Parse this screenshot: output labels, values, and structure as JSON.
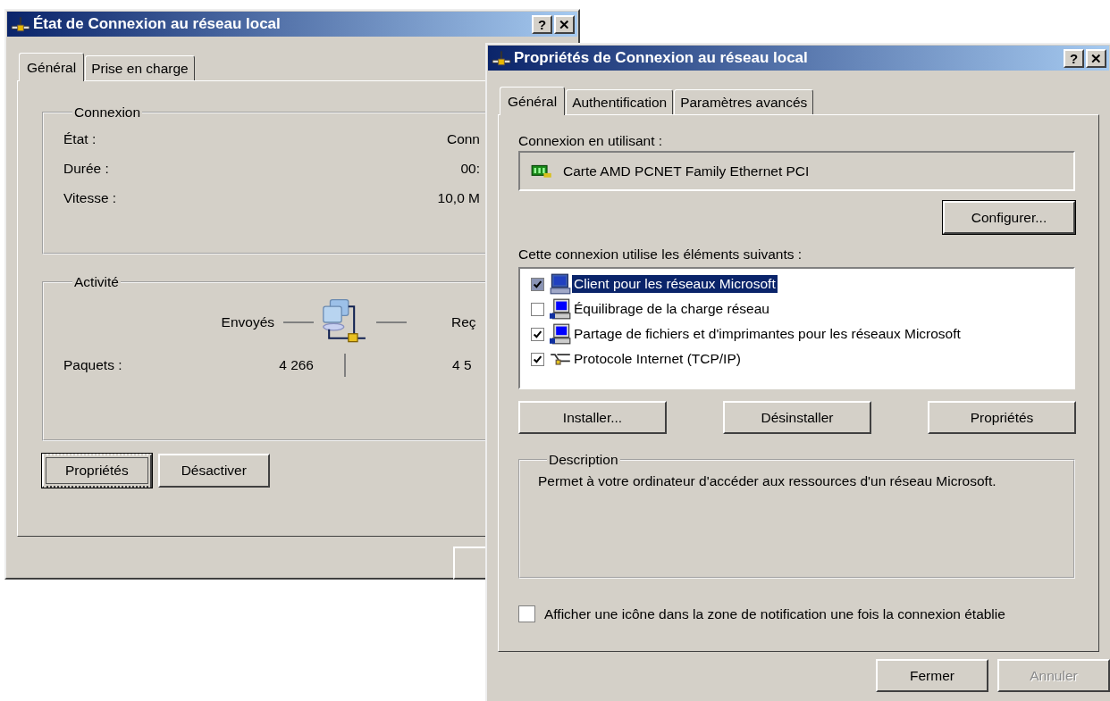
{
  "back_window": {
    "title": "État de Connexion au réseau local",
    "title_buttons": [
      "?",
      "✕"
    ],
    "tabs": [
      {
        "label": "Général",
        "selected": true
      },
      {
        "label": "Prise en charge",
        "selected": false
      }
    ],
    "connection_group": {
      "title": "Connexion",
      "rows": [
        {
          "label": "État :",
          "value": "Conn"
        },
        {
          "label": "Durée :",
          "value": "00:"
        },
        {
          "label": "Vitesse :",
          "value": "10,0 M"
        }
      ]
    },
    "activity_group": {
      "title": "Activité",
      "sent_label": "Envoyés",
      "received_label": "Reç",
      "packets": {
        "label": "Paquets :",
        "sent": "4 266",
        "received": "4 5"
      }
    },
    "buttons": [
      {
        "label": "Propriétés",
        "focused": true
      },
      {
        "label": "Désactiver",
        "focused": false
      }
    ]
  },
  "front_window": {
    "title": "Propriétés de Connexion au réseau local",
    "title_buttons": [
      "?",
      "✕"
    ],
    "tabs": [
      {
        "label": "Général",
        "selected": true
      },
      {
        "label": "Authentification",
        "selected": false
      },
      {
        "label": "Paramètres avancés",
        "selected": false
      }
    ],
    "adapter_label": "Connexion en utilisant :",
    "adapter_name": "Carte AMD PCNET Family Ethernet PCI",
    "configure_button": "Configurer...",
    "components_label": "Cette connexion utilise les éléments suivants :",
    "components": [
      {
        "label": "Client pour les réseaux Microsoft",
        "kind": "client",
        "checked": true,
        "selected": true
      },
      {
        "label": "Équilibrage de la charge réseau",
        "kind": "service",
        "checked": false,
        "selected": false
      },
      {
        "label": "Partage de fichiers et d'imprimantes pour les réseaux Microsoft",
        "kind": "service",
        "checked": true,
        "selected": false
      },
      {
        "label": "Protocole Internet (TCP/IP)",
        "kind": "protocol",
        "checked": true,
        "selected": false
      }
    ],
    "component_buttons": [
      "Installer...",
      "Désinstaller",
      "Propriétés"
    ],
    "description": {
      "title": "Description",
      "text": "Permet à votre ordinateur d'accéder aux ressources d'un réseau Microsoft."
    },
    "notify_checkbox": {
      "label": "Afficher une icône dans la zone de notification une fois la connexion établie",
      "checked": false
    },
    "buttons": [
      {
        "label": "Fermer",
        "disabled": false
      },
      {
        "label": "Annuler",
        "disabled": true
      }
    ]
  }
}
